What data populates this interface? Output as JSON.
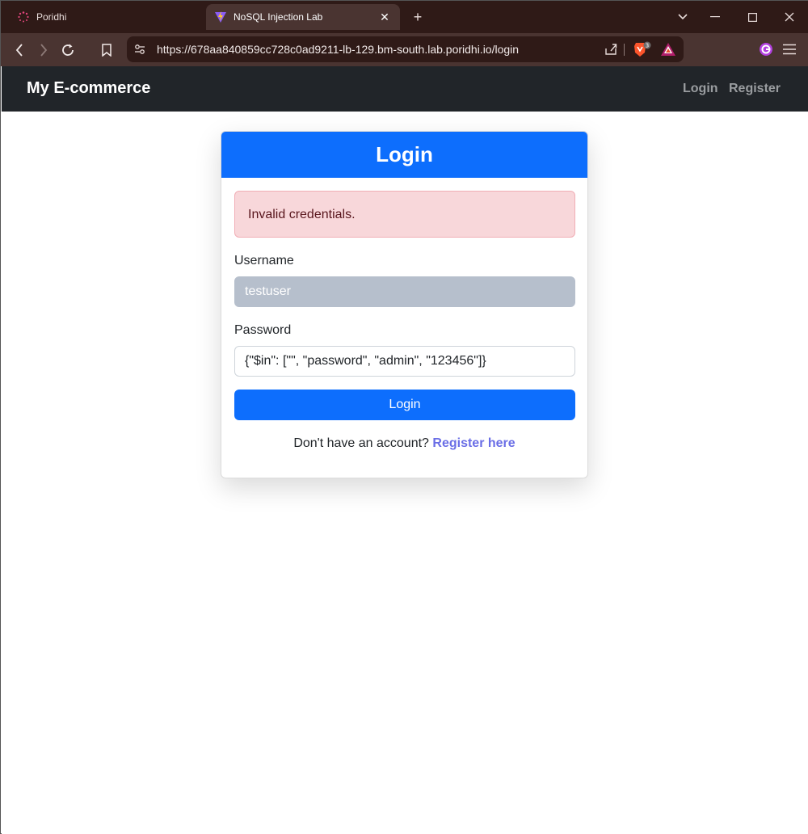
{
  "browser": {
    "tabs": [
      {
        "title": "Poridhi",
        "active": false
      },
      {
        "title": "NoSQL Injection Lab",
        "active": true
      }
    ],
    "url": "https://678aa840859cc728c0ad9211-lb-129.bm-south.lab.poridhi.io/login",
    "brave_shield_count": "3"
  },
  "navbar": {
    "brand": "My E-commerce",
    "links": [
      "Login",
      "Register"
    ]
  },
  "login_card": {
    "title": "Login",
    "alert": "Invalid credentials.",
    "username_label": "Username",
    "username_value": "testuser",
    "password_label": "Password",
    "password_value": "{\"$in\": [\"\", \"password\", \"admin\", \"123456\"]}",
    "submit_label": "Login",
    "footer_prompt": "Don't have an account?",
    "footer_link": "Register here"
  },
  "colors": {
    "primary": "#0d6efd",
    "navbar_bg": "#212529",
    "alert_bg": "#f8d7da",
    "alert_text": "#58151c",
    "browser_frame": "#2f1a17"
  }
}
